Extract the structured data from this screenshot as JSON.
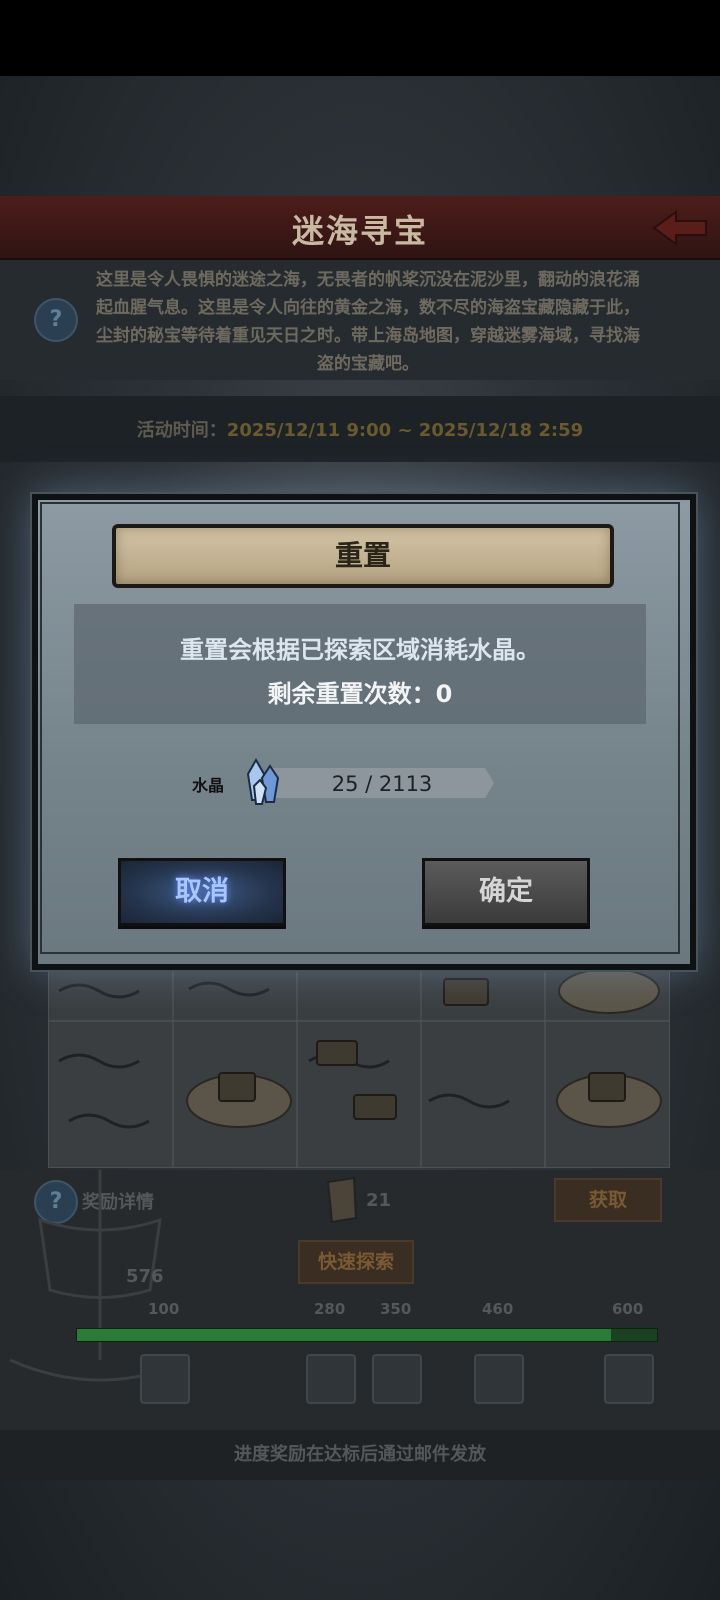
{
  "header": {
    "title": "迷海寻宝"
  },
  "description": "这里是令人畏惧的迷途之海，无畏者的帆桨沉没在泥沙里，翻动的浪花涌起血腥气息。这里是令人向往的黄金之海，数不尽的海盗宝藏隐藏于此，尘封的秘宝等待着重见天日之时。带上海岛地图，穿越迷雾海域，寻找海盗的宝藏吧。",
  "activity": {
    "label": "活动时间：",
    "value": "2025/12/11 9:00 ~ 2025/12/18 2:59"
  },
  "rewards": {
    "details_label": "奖励详情",
    "map_count": "21",
    "obtain_label": "获取",
    "quick_explore_label": "快速探索",
    "progress_value": "576",
    "progress_fraction": 0.92,
    "milestones": [
      "100",
      "280",
      "350",
      "460",
      "600"
    ]
  },
  "footer_note": "进度奖励在达标后通过邮件发放",
  "dialog": {
    "title": "重置",
    "message": "重置会根据已探索区域消耗水晶。",
    "remaining_label": "剩余重置次数：0",
    "crystal_label": "水晶",
    "crystal_value": "25 / 2113",
    "cancel_label": "取消",
    "confirm_label": "确定"
  },
  "colors": {
    "cancel_glow": "#5f8cff",
    "title_bar": "#4e1d1a",
    "progress": "#1b4220"
  },
  "icons": [
    "back-arrow-icon",
    "help-icon",
    "crystal-icon",
    "map-scroll-icon",
    "treasure-chest-icon",
    "ship-icon"
  ]
}
